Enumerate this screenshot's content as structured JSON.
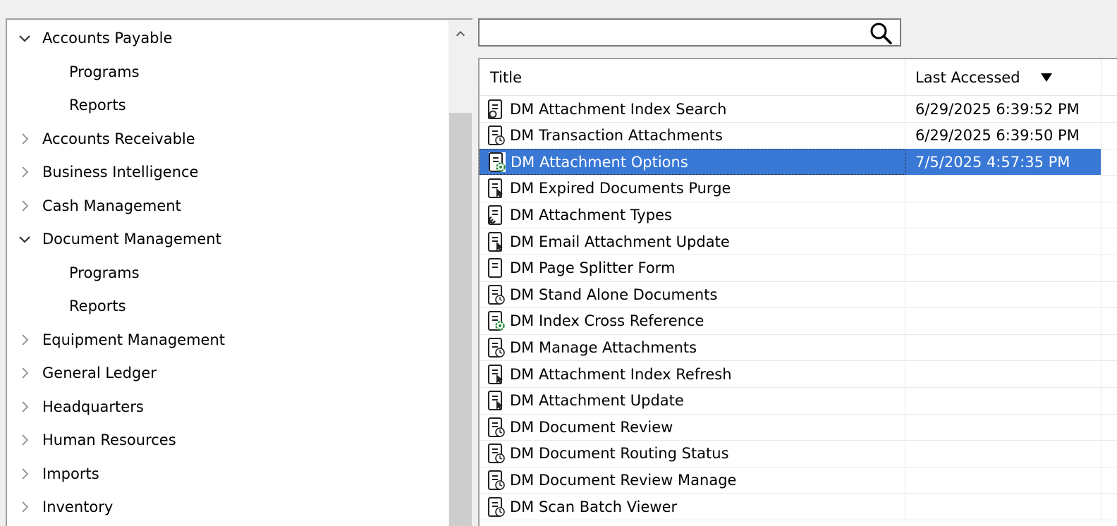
{
  "tree": {
    "items": [
      {
        "label": "Accounts Payable",
        "level": 0,
        "expanded": true
      },
      {
        "label": "Programs",
        "level": 1
      },
      {
        "label": "Reports",
        "level": 1
      },
      {
        "label": "Accounts Receivable",
        "level": 0,
        "expanded": false
      },
      {
        "label": "Business Intelligence",
        "level": 0,
        "expanded": false
      },
      {
        "label": "Cash Management",
        "level": 0,
        "expanded": false
      },
      {
        "label": "Document Management",
        "level": 0,
        "expanded": true
      },
      {
        "label": "Programs",
        "level": 1
      },
      {
        "label": "Reports",
        "level": 1
      },
      {
        "label": "Equipment Management",
        "level": 0,
        "expanded": false
      },
      {
        "label": "General Ledger",
        "level": 0,
        "expanded": false
      },
      {
        "label": "Headquarters",
        "level": 0,
        "expanded": false
      },
      {
        "label": "Human Resources",
        "level": 0,
        "expanded": false
      },
      {
        "label": "Imports",
        "level": 0,
        "expanded": false
      },
      {
        "label": "Inventory",
        "level": 0,
        "expanded": false
      }
    ]
  },
  "search": {
    "value": "",
    "placeholder": ""
  },
  "grid": {
    "columns": {
      "title": "Title",
      "last_accessed": "Last Accessed"
    },
    "sort_indicator": "sort-descending-icon",
    "rows": [
      {
        "title": "DM Attachment Index Search",
        "last_accessed": "6/29/2025 6:39:52 PM",
        "icon": "search-form-icon"
      },
      {
        "title": "DM Transaction Attachments",
        "last_accessed": "6/29/2025 6:39:50 PM",
        "icon": "clock-form-icon"
      },
      {
        "title": "DM Attachment Options",
        "last_accessed": "7/5/2025 4:57:35 PM",
        "icon": "gear-form-icon",
        "selected": true
      },
      {
        "title": "DM Expired Documents Purge",
        "last_accessed": "",
        "icon": "cursor-form-icon"
      },
      {
        "title": "DM Attachment Types",
        "last_accessed": "",
        "icon": "wrench-form-icon"
      },
      {
        "title": "DM Email Attachment Update",
        "last_accessed": "",
        "icon": "cursor-form-icon"
      },
      {
        "title": "DM Page Splitter Form",
        "last_accessed": "",
        "icon": "form-icon"
      },
      {
        "title": "DM Stand Alone Documents",
        "last_accessed": "",
        "icon": "clock-form-icon"
      },
      {
        "title": "DM Index Cross Reference",
        "last_accessed": "",
        "icon": "gear-form-icon"
      },
      {
        "title": "DM Manage Attachments",
        "last_accessed": "",
        "icon": "clock-form-icon"
      },
      {
        "title": "DM Attachment Index Refresh",
        "last_accessed": "",
        "icon": "cursor-form-icon"
      },
      {
        "title": "DM Attachment Update",
        "last_accessed": "",
        "icon": "cursor-form-icon"
      },
      {
        "title": "DM Document Review",
        "last_accessed": "",
        "icon": "clock-form-icon"
      },
      {
        "title": "DM Document Routing Status",
        "last_accessed": "",
        "icon": "clock-form-icon"
      },
      {
        "title": "DM Document Review Manage",
        "last_accessed": "",
        "icon": "clock-form-icon"
      },
      {
        "title": "DM Scan Batch Viewer",
        "last_accessed": "",
        "icon": "clock-form-icon"
      }
    ]
  }
}
